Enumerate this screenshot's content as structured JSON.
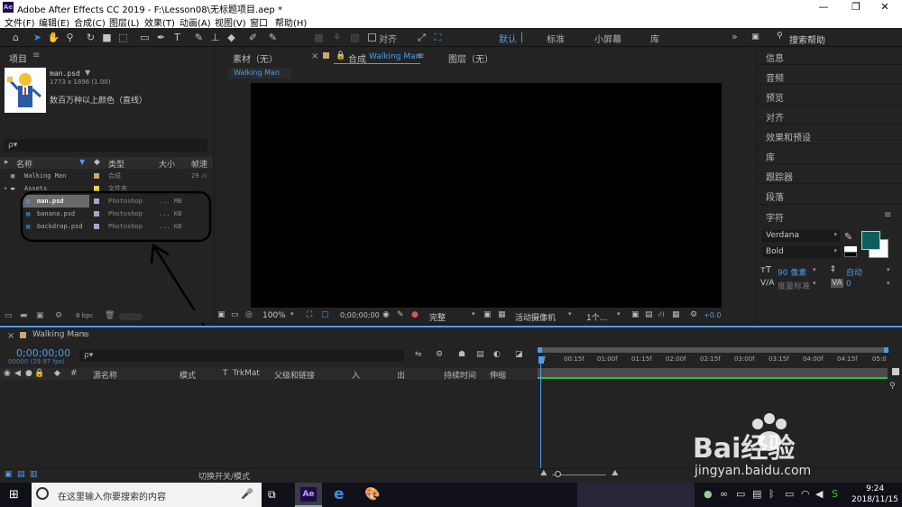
{
  "window": {
    "title": "Adobe After Effects CC 2019 - F:\\Lesson08\\无标题项目.aep *",
    "app_badge": "Ae"
  },
  "menu": [
    "文件(F)",
    "编辑(E)",
    "合成(C)",
    "图层(L)",
    "效果(T)",
    "动画(A)",
    "视图(V)",
    "窗口",
    "帮助(H)"
  ],
  "toolbar": {
    "align_label": "对齐",
    "workspaces": [
      "默认",
      "标准",
      "小屏幕",
      "库"
    ],
    "search_placeholder": "搜索帮助",
    "more": "»"
  },
  "project": {
    "title": "项目",
    "thumb_name": "man.psd",
    "thumb_size": "1773 x 1896 (1.00)",
    "thumb_color_desc": "数百万种以上颜色（直线）",
    "search_placeholder": "ρ▾",
    "columns": {
      "name": "名称",
      "type": "类型",
      "size": "大小",
      "fps": "帧速"
    },
    "items": [
      {
        "name": "Walking Man",
        "type": "合成",
        "size": "",
        "fps": "29",
        "color": "#c8a971"
      },
      {
        "name": "Assets",
        "type": "文件夹",
        "size": "",
        "fps": "",
        "color": "#e5d34a"
      },
      {
        "name": "man.psd",
        "type": "Photoshop",
        "size": "... MB",
        "fps": "",
        "color": "#a9a3cf"
      },
      {
        "name": "banana.psd",
        "type": "Photoshop",
        "size": "... KB",
        "fps": "",
        "color": "#a9a3cf"
      },
      {
        "name": "backdrop.psd",
        "type": "Photoshop",
        "size": "... KB",
        "fps": "",
        "color": "#a9a3cf"
      }
    ],
    "bpc": "8 bpc"
  },
  "viewer": {
    "footage_tab": "素材（无）",
    "comp_tab_prefix": "合成",
    "comp_name": "Walking Man",
    "layer_tab": "图层（无）",
    "comp_pill": "Walking Man",
    "zoom": "100%",
    "timecode": "0;00;00;00",
    "quality": "完整",
    "camera": "活动摄像机",
    "views": "1个...",
    "exposure": "+0.0"
  },
  "right_panels": [
    "信息",
    "音频",
    "预览",
    "对齐",
    "效果和预设",
    "库",
    "跟踪器",
    "段落"
  ],
  "character": {
    "title": "字符",
    "font": "Verdana",
    "style": "Bold",
    "size": "90 像素",
    "leading": "自动",
    "tracking_label": "度量标准",
    "tracking_value": "0"
  },
  "timeline": {
    "comp_name": "Walking Man",
    "timecode": "0;00;00;00",
    "frames": "00000 (29.97 fps)",
    "search_placeholder": "ρ▾",
    "columns": [
      "源名称",
      "模式",
      "T",
      "TrkMat",
      "父级和链接",
      "入",
      "出",
      "持续时间",
      "伸缩"
    ],
    "ruler": [
      "0f",
      "00:15f",
      "01:00f",
      "01:15f",
      "02:00f",
      "02:15f",
      "03:00f",
      "03:15f",
      "04:00f",
      "04:15f",
      "05:0"
    ],
    "toggle_label": "切换开关/模式"
  },
  "taskbar": {
    "search_placeholder": "在这里输入你要搜索的内容",
    "time": "9:24",
    "date": "2018/11/15"
  },
  "watermark": {
    "logo": "Bai经验",
    "url": "jingyan.baidu.com"
  }
}
